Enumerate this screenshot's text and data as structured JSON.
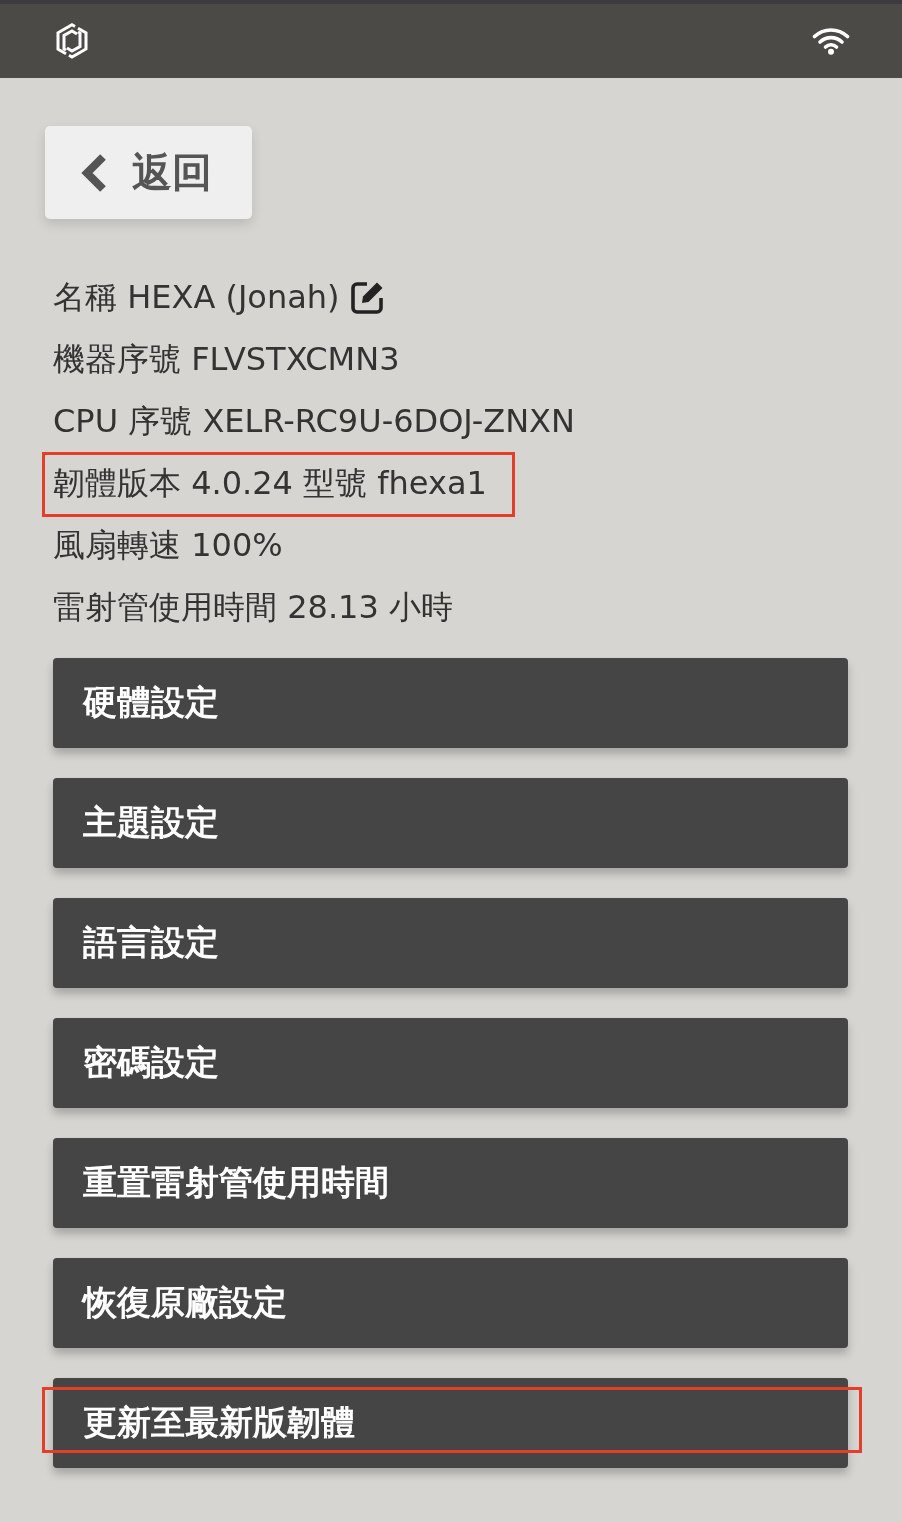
{
  "back_button": {
    "label": "返回"
  },
  "info": [
    {
      "text": "名稱 HEXA (Jonah)",
      "editable": true,
      "highlighted": false
    },
    {
      "text": "機器序號 FLVSTXCMN3",
      "editable": false,
      "highlighted": false
    },
    {
      "text": "CPU 序號 XELR-RC9U-6DOJ-ZNXN",
      "editable": false,
      "highlighted": false
    },
    {
      "text": "韌體版本 4.0.24 型號 fhexa1",
      "editable": false,
      "highlighted": true
    },
    {
      "text": "風扇轉速 100%",
      "editable": false,
      "highlighted": false
    },
    {
      "text": "雷射管使用時間 28.13 小時",
      "editable": false,
      "highlighted": false
    }
  ],
  "menu": [
    {
      "label": "硬體設定",
      "highlighted": false
    },
    {
      "label": "主題設定",
      "highlighted": false
    },
    {
      "label": "語言設定",
      "highlighted": false
    },
    {
      "label": "密碼設定",
      "highlighted": false
    },
    {
      "label": "重置雷射管使用時間",
      "highlighted": false
    },
    {
      "label": "恢復原廠設定",
      "highlighted": false
    },
    {
      "label": "更新至最新版韌體",
      "highlighted": true
    }
  ]
}
